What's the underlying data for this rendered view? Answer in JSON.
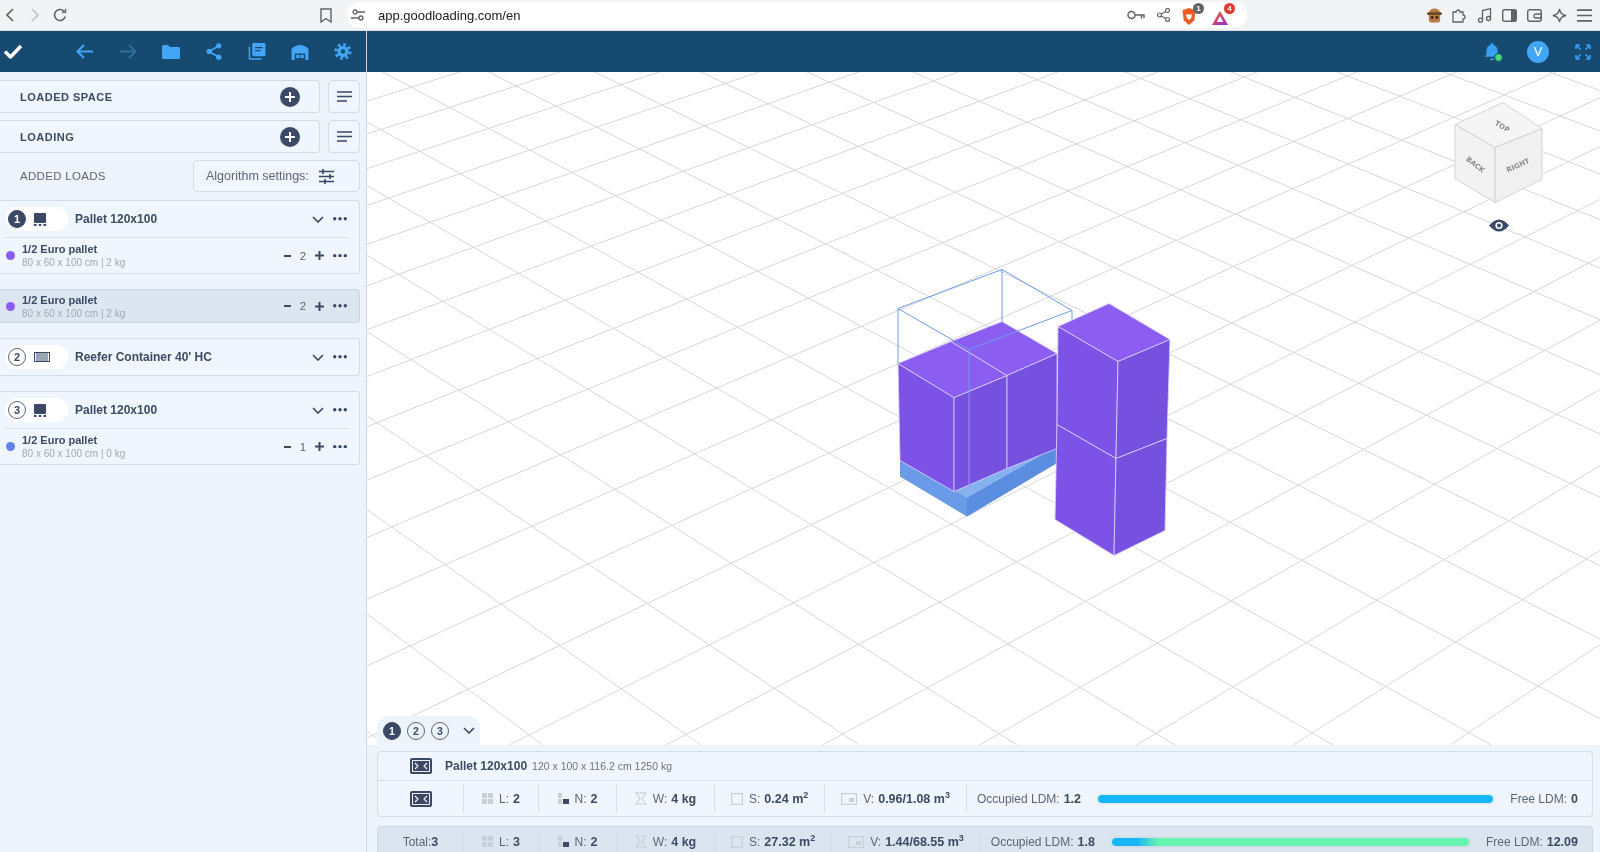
{
  "browser": {
    "back_disabled": false,
    "forward_disabled": true,
    "url": "app.goodloading.com/en",
    "shields_count": "1",
    "rewards_count": "4"
  },
  "toolbar": {
    "undo": {
      "disabled": false
    },
    "redo": {
      "disabled": true
    }
  },
  "header": {
    "avatar_initial": "V"
  },
  "sidebar": {
    "sections": [
      {
        "label": "LOADED SPACE"
      },
      {
        "label": "LOADING"
      }
    ],
    "added_loads": {
      "label": "ADDED LOADS",
      "algorithm_button": "Algorithm settings:"
    },
    "entries": [
      {
        "kind": "pallet",
        "number": "1",
        "selected": true,
        "title": "Pallet 120x100",
        "loads": [
          {
            "name": "1/2 Euro pallet",
            "details": "80 x 60 x 100 cm | 2 kg",
            "color": "#8b5cf6",
            "quantity": "2",
            "selected": false
          }
        ]
      },
      {
        "kind": "load",
        "name": "1/2 Euro pallet",
        "details": "80 x 60 x 100 cm | 2 kg",
        "color": "#8b5cf6",
        "quantity": "2",
        "selected": true
      },
      {
        "kind": "container",
        "number": "2",
        "selected": false,
        "title": "Reefer Container 40' HC"
      },
      {
        "kind": "pallet",
        "number": "3",
        "selected": false,
        "title": "Pallet 120x100",
        "loads": [
          {
            "name": "1/2 Euro pallet",
            "details": "80 x 60 x 100 cm | 0 kg",
            "color": "#6382f0",
            "quantity": "1",
            "selected": false
          }
        ]
      }
    ]
  },
  "view": {
    "cube_faces": [
      "TOP",
      "BACK",
      "RIGHT"
    ]
  },
  "space_tabs": [
    {
      "label": "1",
      "selected": true
    },
    {
      "label": "2",
      "selected": false
    },
    {
      "label": "3",
      "selected": false
    }
  ],
  "summary": {
    "space": {
      "name": "Pallet 120x100",
      "details": "120 x 100 x 116.2 cm 1250 kg",
      "stats": [
        {
          "kind": "layers",
          "label": "L:",
          "value": "2"
        },
        {
          "kind": "count",
          "label": "N:",
          "value": "2"
        },
        {
          "kind": "weight",
          "label": "W:",
          "value": "4 kg"
        },
        {
          "kind": "area",
          "label": "S:",
          "value": "0.24 m$^{2}$"
        },
        {
          "kind": "volume",
          "label": "V:",
          "value": "0.96/1.08 m$^{3}$"
        }
      ],
      "occupied": {
        "label": "Occupied LDM:",
        "value": "1.2",
        "level": 1
      },
      "free": {
        "label": "Free LDM:",
        "value": "0"
      }
    },
    "total": {
      "label": "Total:",
      "value": "3",
      "stats": [
        {
          "kind": "layers",
          "label": "L:",
          "value": "3"
        },
        {
          "kind": "count",
          "label": "N:",
          "value": "2"
        },
        {
          "kind": "weight",
          "label": "W:",
          "value": "4 kg"
        },
        {
          "kind": "area",
          "label": "S:",
          "value": "27.32 m$^{2}$"
        },
        {
          "kind": "volume",
          "label": "V:",
          "value": "1.44/68.55 m$^{3}$"
        }
      ],
      "occupied": {
        "label": "Occupied LDM:",
        "value": "1.8",
        "level": 0.13
      },
      "free": {
        "label": "Free LDM:",
        "value": "12.09"
      }
    }
  }
}
